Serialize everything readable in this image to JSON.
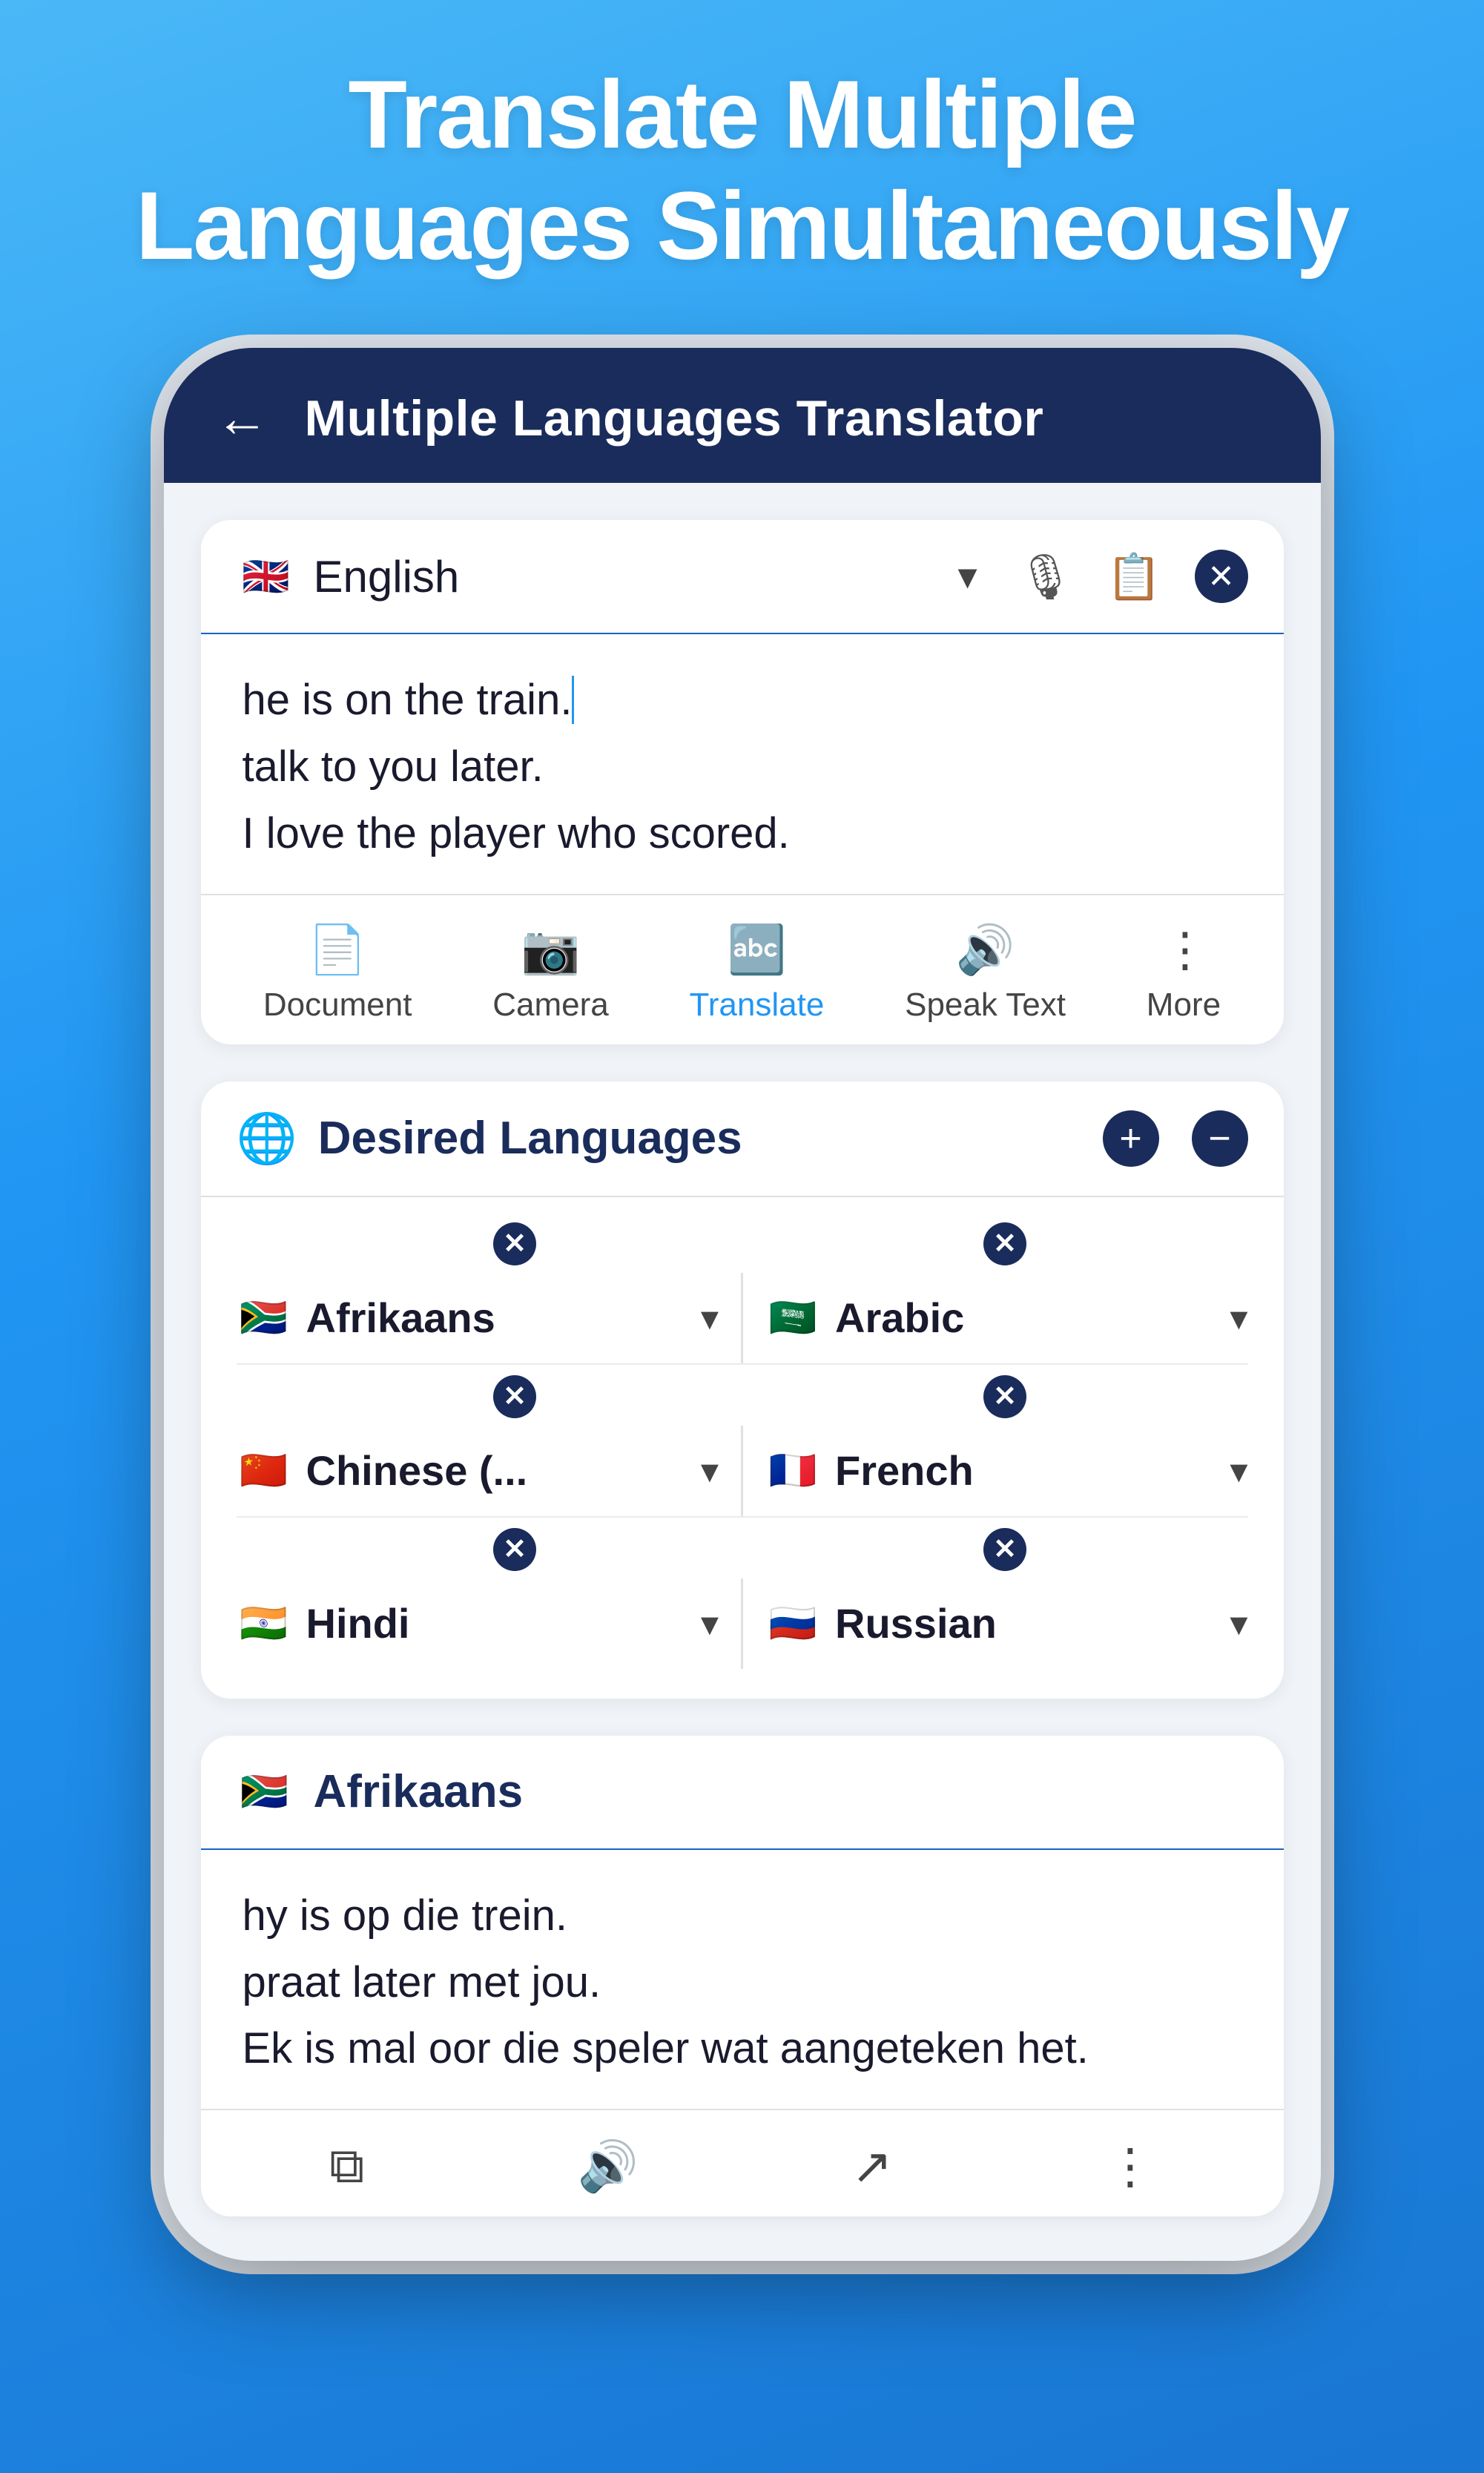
{
  "headline": {
    "line1": "Translate Multiple",
    "line2": "Languages Simultaneously"
  },
  "app_header": {
    "title": "Multiple Languages Translator",
    "back_label": "←"
  },
  "input_card": {
    "language": "English",
    "dropdown_symbol": "▾",
    "text_lines": [
      "he is on the train.",
      "talk to you later.",
      "I love the player who scored."
    ]
  },
  "toolbar": {
    "items": [
      {
        "id": "document",
        "label": "Document",
        "icon": "📄",
        "active": false
      },
      {
        "id": "camera",
        "label": "Camera",
        "icon": "📷",
        "active": false
      },
      {
        "id": "translate",
        "label": "Translate",
        "icon": "🔤",
        "active": true
      },
      {
        "id": "speak_text",
        "label": "Speak Text",
        "icon": "🔊",
        "active": false
      },
      {
        "id": "more",
        "label": "More",
        "icon": "⋮",
        "active": false
      }
    ]
  },
  "desired_languages": {
    "title": "Desired Languages",
    "add_label": "+",
    "remove_label": "−",
    "pairs": [
      {
        "left": {
          "name": "Afrikaans",
          "flag": "🇿🇦"
        },
        "right": {
          "name": "Arabic",
          "flag": "🇸🇦"
        }
      },
      {
        "left": {
          "name": "Chinese (...",
          "flag": "🇨🇳"
        },
        "right": {
          "name": "French",
          "flag": "🇫🇷"
        }
      },
      {
        "left": {
          "name": "Hindi",
          "flag": "🇮🇳"
        },
        "right": {
          "name": "Russian",
          "flag": "🇷🇺"
        }
      }
    ]
  },
  "result_card": {
    "language": "Afrikaans",
    "flag": "🇿🇦",
    "text_lines": [
      "hy is op die trein.",
      "praat later met jou.",
      "Ek is mal oor die speler wat aangeteken het."
    ],
    "toolbar_icons": [
      "copy",
      "speak",
      "share",
      "more"
    ]
  },
  "colors": {
    "header_bg": "#1a2c5b",
    "accent": "#2196f3",
    "text_dark": "#1a1a2e",
    "card_bg": "#ffffff",
    "bg_gradient_top": "#5bbff8",
    "bg_gradient_bottom": "#1976d2"
  }
}
